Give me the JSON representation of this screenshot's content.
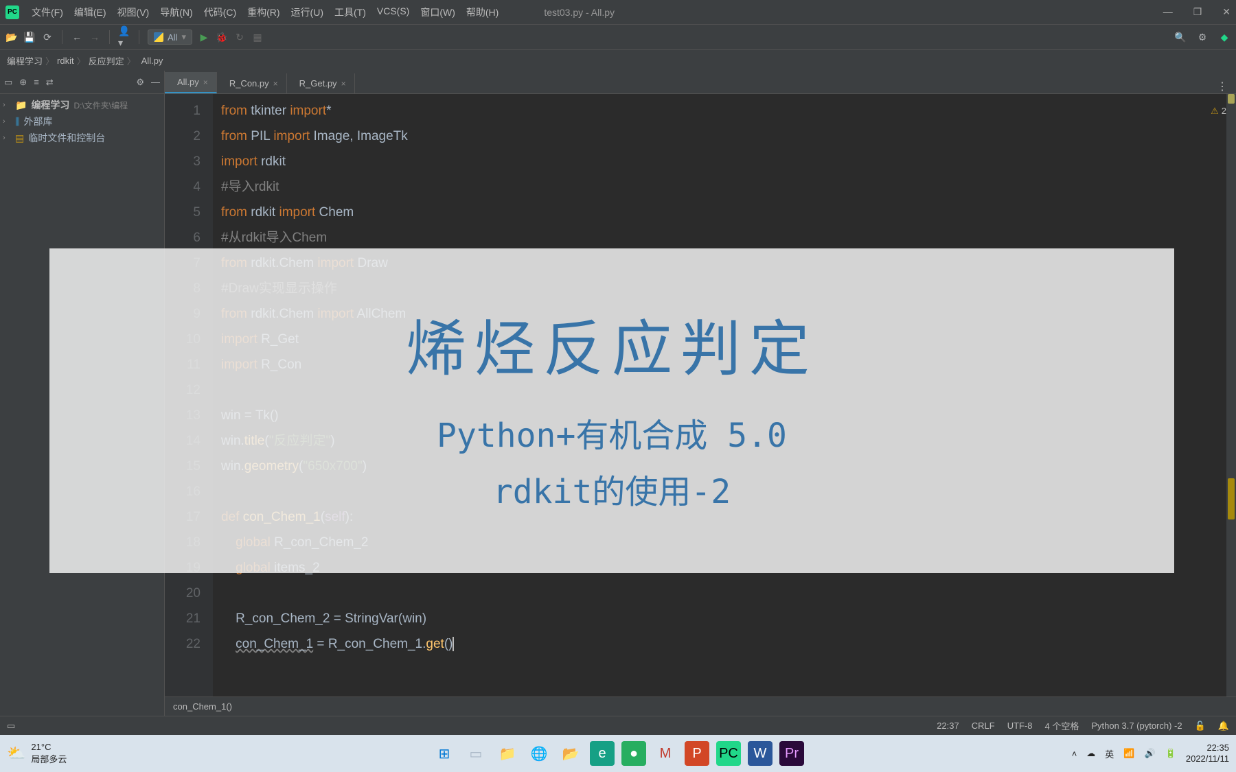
{
  "titlebar": {
    "filename": "test03.py - All.py",
    "menus": [
      "文件(F)",
      "编辑(E)",
      "视图(V)",
      "导航(N)",
      "代码(C)",
      "重构(R)",
      "运行(U)",
      "工具(T)",
      "VCS(S)",
      "窗口(W)",
      "帮助(H)"
    ]
  },
  "toolbar": {
    "config": "All"
  },
  "breadcrumb": [
    "编程学习",
    "rdkit",
    "反应判定",
    "All.py"
  ],
  "project": {
    "root_label": "编程学习",
    "root_path": "D:\\文件夹\\编程",
    "ext_lib": "外部库",
    "scratch": "临时文件和控制台"
  },
  "tabs": [
    {
      "label": "All.py",
      "active": true
    },
    {
      "label": "R_Con.py",
      "active": false
    },
    {
      "label": "R_Get.py",
      "active": false
    }
  ],
  "warning_count": "2",
  "code_lines": [
    {
      "n": "1",
      "html": "<span class='kw'>from</span> <span class='id'>tkinter</span> <span class='kw'>import</span>*"
    },
    {
      "n": "2",
      "html": "<span class='kw'>from</span> <span class='id'>PIL</span> <span class='kw'>import</span> <span class='id'>Image</span>, <span class='id'>ImageTk</span>"
    },
    {
      "n": "3",
      "html": "<span class='kw'>import</span> <span class='id'>rdkit</span>"
    },
    {
      "n": "4",
      "html": "<span class='com'>#导入rdkit</span>"
    },
    {
      "n": "5",
      "html": "<span class='kw'>from</span> <span class='id'>rdkit</span> <span class='kw'>import</span> <span class='id'>Chem</span>"
    },
    {
      "n": "6",
      "html": "<span class='com'>#从rdkit导入Chem</span>"
    },
    {
      "n": "7",
      "html": "<span class='kw'>from</span> <span class='id'>rdkit.Chem</span> <span class='kw'>import</span> <span class='id'>Draw</span>"
    },
    {
      "n": "8",
      "html": "<span class='com'>#Draw实现显示操作</span>"
    },
    {
      "n": "9",
      "html": "<span class='kw'>from</span> <span class='id'>rdkit.Chem</span> <span class='kw'>import</span> <span class='id'>AllChem</span>"
    },
    {
      "n": "10",
      "html": "<span class='kw'>import</span> <span class='id'>R_Get</span>"
    },
    {
      "n": "11",
      "html": "<span class='kw'>import</span> <span class='id'>R_Con</span>"
    },
    {
      "n": "12",
      "html": ""
    },
    {
      "n": "13",
      "html": "<span class='id'>win</span> = <span class='id'>Tk</span>()"
    },
    {
      "n": "14",
      "html": "<span class='id'>win</span>.<span class='fn'>title</span>(<span class='str'>\"反应判定\"</span>)"
    },
    {
      "n": "15",
      "html": "<span class='id'>win</span>.<span class='fn'>geometry</span>(<span class='str'>\"650x700\"</span>)"
    },
    {
      "n": "16",
      "html": ""
    },
    {
      "n": "17",
      "html": "<span class='kw'>def</span> <span class='fn'>con_Chem_1</span>(<span class='var'>self</span>):"
    },
    {
      "n": "18",
      "html": "    <span class='kw'>global</span> <span class='id'>R_con_Chem_2</span>"
    },
    {
      "n": "19",
      "html": "    <span class='kw'>global</span> <span class='id'>items_2</span>"
    },
    {
      "n": "20",
      "html": ""
    },
    {
      "n": "21",
      "html": "    <span class='id'>R_con_Chem_2</span> = <span class='id'>StringVar</span>(<span class='id'>win</span>)"
    },
    {
      "n": "22",
      "html": "    <span class='underline'>con_Chem_1</span> = <span class='id'>R_con_Chem_1</span>.<span class='fn'>get</span>()<span class='cursor'></span>"
    }
  ],
  "context_fn": "con_Chem_1()",
  "statusbar": {
    "time": "22:37",
    "line_ending": "CRLF",
    "encoding": "UTF-8",
    "indent": "4 个空格",
    "interpreter": "Python 3.7 (pytorch) -2"
  },
  "overlay": {
    "title": "烯烃反应判定",
    "sub1": "Python+有机合成 5.0",
    "sub2": "rdkit的使用-2"
  },
  "taskbar": {
    "temp": "21°C",
    "weather": "局部多云",
    "clock_time": "22:35",
    "clock_date": "2022/11/11"
  }
}
